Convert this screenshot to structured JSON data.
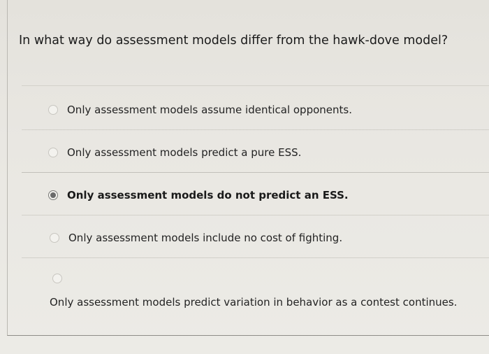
{
  "question": {
    "text": "In what way do assessment models differ from the hawk-dove model?"
  },
  "options": [
    {
      "label": "Only assessment models assume identical opponents.",
      "selected": false
    },
    {
      "label": "Only assessment models predict a pure ESS.",
      "selected": false
    },
    {
      "label": "Only assessment models do not predict an ESS.",
      "selected": true
    },
    {
      "label": "Only assessment models include no cost of fighting.",
      "selected": false
    },
    {
      "label": "Only assessment models predict variation in behavior as a contest continues.",
      "selected": false
    }
  ]
}
